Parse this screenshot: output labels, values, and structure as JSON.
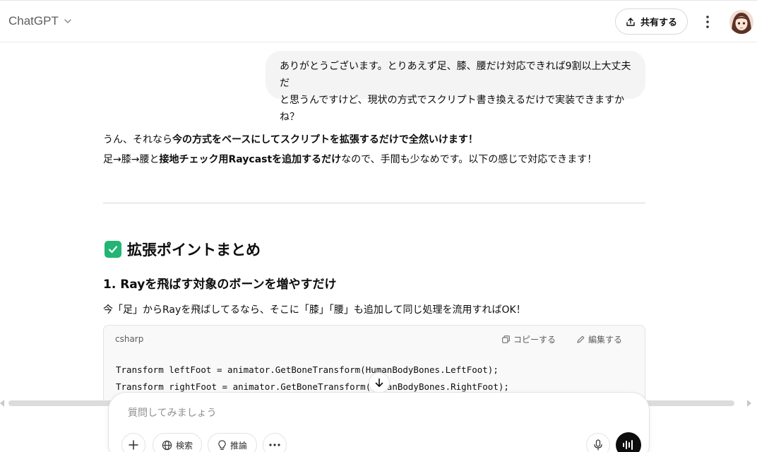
{
  "header": {
    "model_name": "ChatGPT",
    "share_label": "共有する"
  },
  "conversation": {
    "user_message": {
      "line1": "ありがとうございます。とりあえず足、膝、腰だけ対応できれば9割以上大丈夫だ",
      "line2": "と思うんですけど、現状の方式でスクリプト書き換えるだけで実装できますかね？"
    },
    "assistant": {
      "line1_a": "うん、それなら",
      "line1_b": "今の方式をベースにしてスクリプトを拡張するだけで全然いけます！",
      "line2_a": "足→膝→腰と",
      "line2_b": "接地チェック用Raycastを追加するだけ",
      "line2_c": "なので、手間も少なめです。以下の感じで対応できます！",
      "section_title": "拡張ポイントまとめ",
      "step1_title": "1. Rayを飛ばす対象のボーンを増やすだけ",
      "step1_text": "今「足」からRayを飛ばしてるなら、そこに「膝」「腰」も追加して同じ処理を流用すればOK！",
      "code": {
        "language": "csharp",
        "copy_label": "コピーする",
        "edit_label": "編集する",
        "lines": [
          "Transform leftFoot = animator.GetBoneTransform(HumanBodyBones.LeftFoot);",
          "Transform rightFoot = animator.GetBoneTransform(HumanBodyBones.RightFoot);"
        ]
      }
    }
  },
  "composer": {
    "placeholder": "質問してみましょう",
    "search_label": "検索",
    "reason_label": "推論"
  },
  "colors": {
    "accent_check": "#22b573",
    "bubble_bg": "#f4f4f4",
    "code_bg": "#f9f9f9"
  }
}
